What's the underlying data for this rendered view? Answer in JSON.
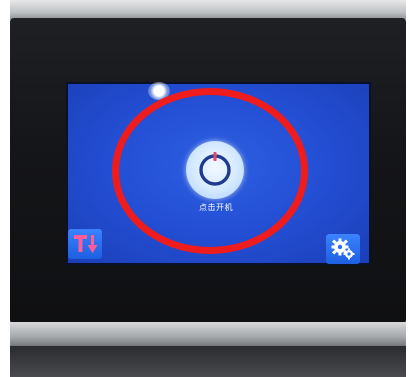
{
  "screen": {
    "power_button": {
      "label": "点击开机",
      "icon": "power-icon"
    },
    "bottom_left_button": {
      "icon": "temperature-down-icon"
    },
    "bottom_right_button": {
      "icon": "settings-gears-icon"
    }
  },
  "annotation": {
    "shape": "ellipse",
    "color": "#ee1c1c",
    "highlights": "power_button"
  },
  "colors": {
    "screen_blue": "#2450d6",
    "button_blue": "#2a6ff0",
    "power_button_face": "#d6ebff",
    "power_ring": "#1f3b8f",
    "power_accent": "#e14a6e",
    "tool_icon_pink": "#ff5c9a"
  }
}
